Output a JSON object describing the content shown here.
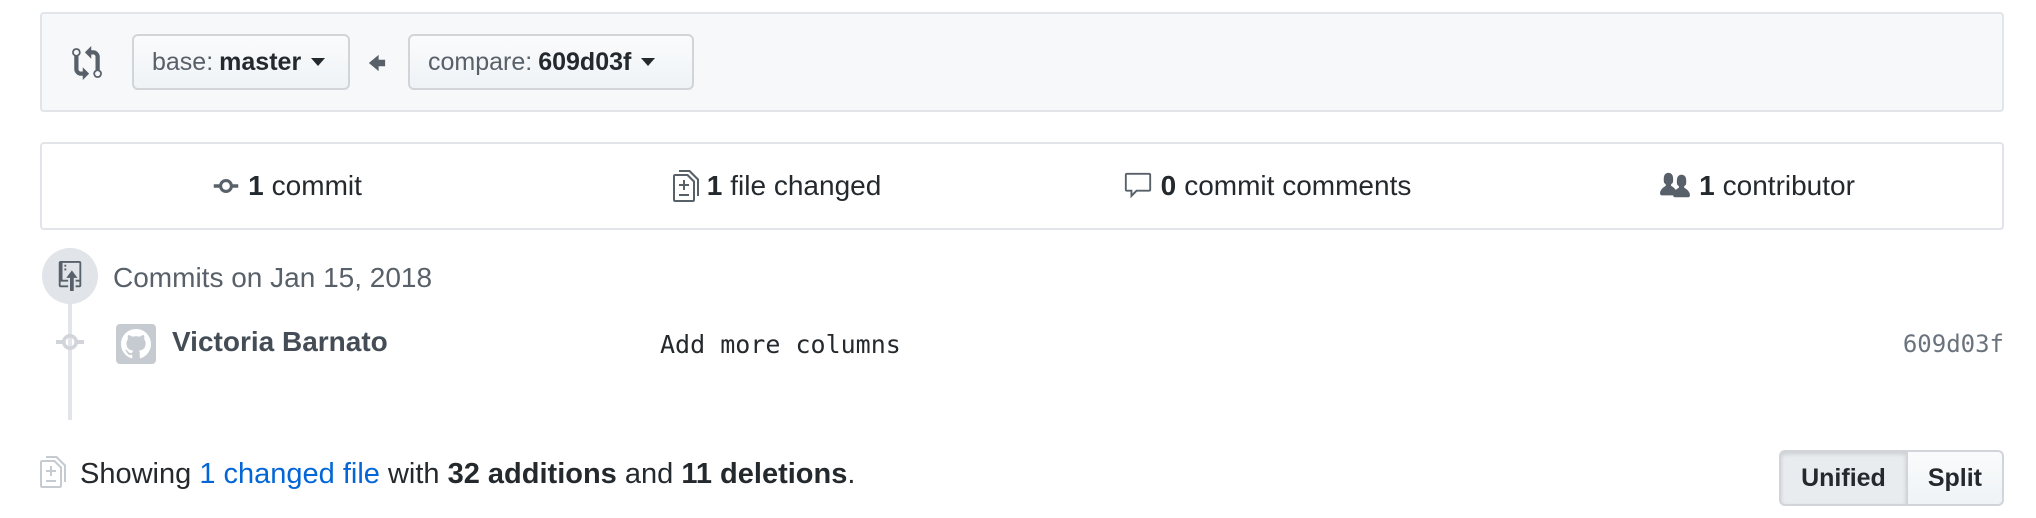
{
  "range": {
    "base_prefix": "base:",
    "base_branch": "master",
    "compare_prefix": "compare:",
    "compare_ref": "609d03f"
  },
  "summary": {
    "commits_count": "1",
    "commits_label": "commit",
    "files_count": "1",
    "files_label": "file changed",
    "comments_count": "0",
    "comments_label": "commit comments",
    "contributors_count": "1",
    "contributors_label": "contributor"
  },
  "commits": {
    "date_heading": "Commits on Jan 15, 2018",
    "items": [
      {
        "author": "Victoria Barnato",
        "message": "Add more columns",
        "sha": "609d03f"
      }
    ]
  },
  "diff_stats": {
    "showing": "Showing",
    "changed_files": "1 changed file",
    "with": "with",
    "additions": "32 additions",
    "and": "and",
    "deletions": "11 deletions",
    "period": "."
  },
  "view_toggle": {
    "unified_label": "Unified",
    "split_label": "Split",
    "selected": "Unified"
  },
  "colors": {
    "link": "#0366d6",
    "border": "#e1e4e8",
    "muted": "#586069",
    "background_subtle": "#f6f8fa"
  }
}
